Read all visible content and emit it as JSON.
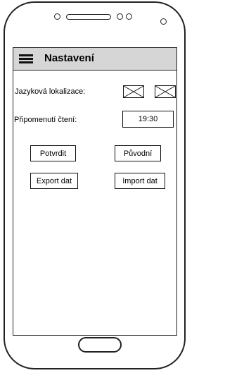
{
  "header": {
    "title": "Nastavení"
  },
  "settings": {
    "language_label": "Jazyková lokalizace:",
    "reminder_label": "Připomenutí čtení:",
    "reminder_time": "19:30"
  },
  "buttons": {
    "confirm": "Potvrdit",
    "original": "Původní",
    "export": "Export dat",
    "import": "Import dat"
  },
  "icons": {
    "menu": "hamburger-menu-icon",
    "flag_placeholder": "image-placeholder-icon",
    "phone_front": [
      "speaker-dot",
      "speaker-grille",
      "camera-dot",
      "home-button"
    ]
  }
}
